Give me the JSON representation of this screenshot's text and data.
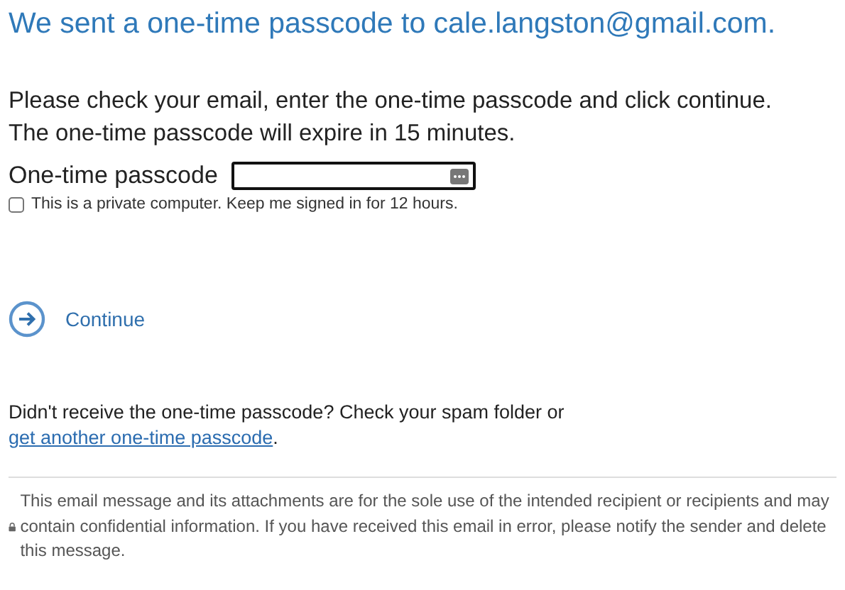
{
  "heading": "We sent a one-time passcode to cale.langston@gmail.com.",
  "instructions": [
    "Please check your email, enter the one-time passcode and click continue.",
    "The one-time passcode will expire in 15 minutes."
  ],
  "passcode_field": {
    "label": "One-time passcode",
    "focused": true
  },
  "keep_signed_in": {
    "label": "This is a private computer. Keep me signed in for 12 hours.",
    "checked": false
  },
  "continue_button": {
    "label": "Continue"
  },
  "resend": {
    "text": "Didn't receive the one-time passcode? Check your spam folder or",
    "link": "get another one-time passcode",
    "end": "."
  },
  "footer": "This email message and its attachments are for the sole use of the intended recipient or recipients and may contain confidential information. If you have received this email in error, please notify the sender and delete this message."
}
